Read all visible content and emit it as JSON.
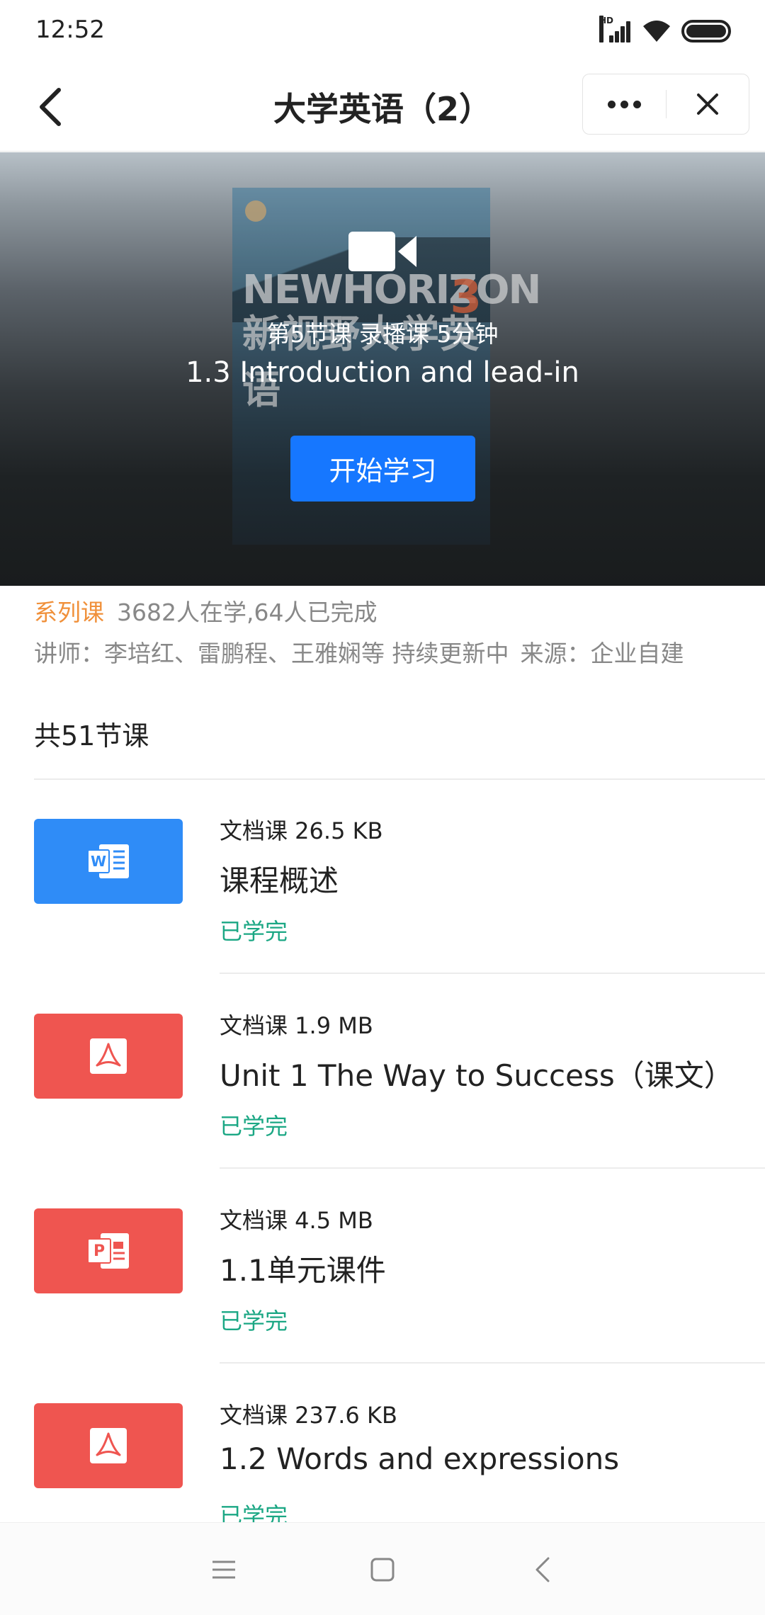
{
  "status_bar": {
    "time": "12:52",
    "network_label": "HD"
  },
  "header": {
    "title": "大学英语（2）"
  },
  "hero": {
    "cover_title": "NEWHORIZON",
    "cover_subtitle": "新视野大学英语",
    "cover_number": "3",
    "lesson_meta": "第5节课 录播课 5分钟",
    "lesson_title": "1.3 Introduction and lead-in",
    "start_button": "开始学习"
  },
  "course_info": {
    "series_label": "系列课",
    "stats": "3682人在学,64人已完成",
    "teachers": "讲师：李培红、雷鹏程、王雅娴等 持续更新中",
    "source": "来源：企业自建",
    "lesson_count": "共51节课"
  },
  "lessons": [
    {
      "meta": "文档课 26.5 KB",
      "title": "课程概述",
      "status": "已学完",
      "icon": "word-icon",
      "color": "#2f8cf7"
    },
    {
      "meta": "文档课 1.9 MB",
      "title": "Unit 1 The Way to Success（课文）",
      "status": "已学完",
      "icon": "pdf-icon",
      "color": "#ef5550"
    },
    {
      "meta": "文档课 4.5 MB",
      "title": "1.1单元课件",
      "status": "已学完",
      "icon": "ppt-icon",
      "color": "#ef5550"
    },
    {
      "meta": "文档课 237.6 KB",
      "title": "1.2 Words and expressions",
      "status": "已学完",
      "icon": "pdf-icon",
      "color": "#ef5550"
    }
  ],
  "nav_bar": {
    "icons": [
      "menu-icon",
      "home-icon",
      "back-icon"
    ]
  }
}
